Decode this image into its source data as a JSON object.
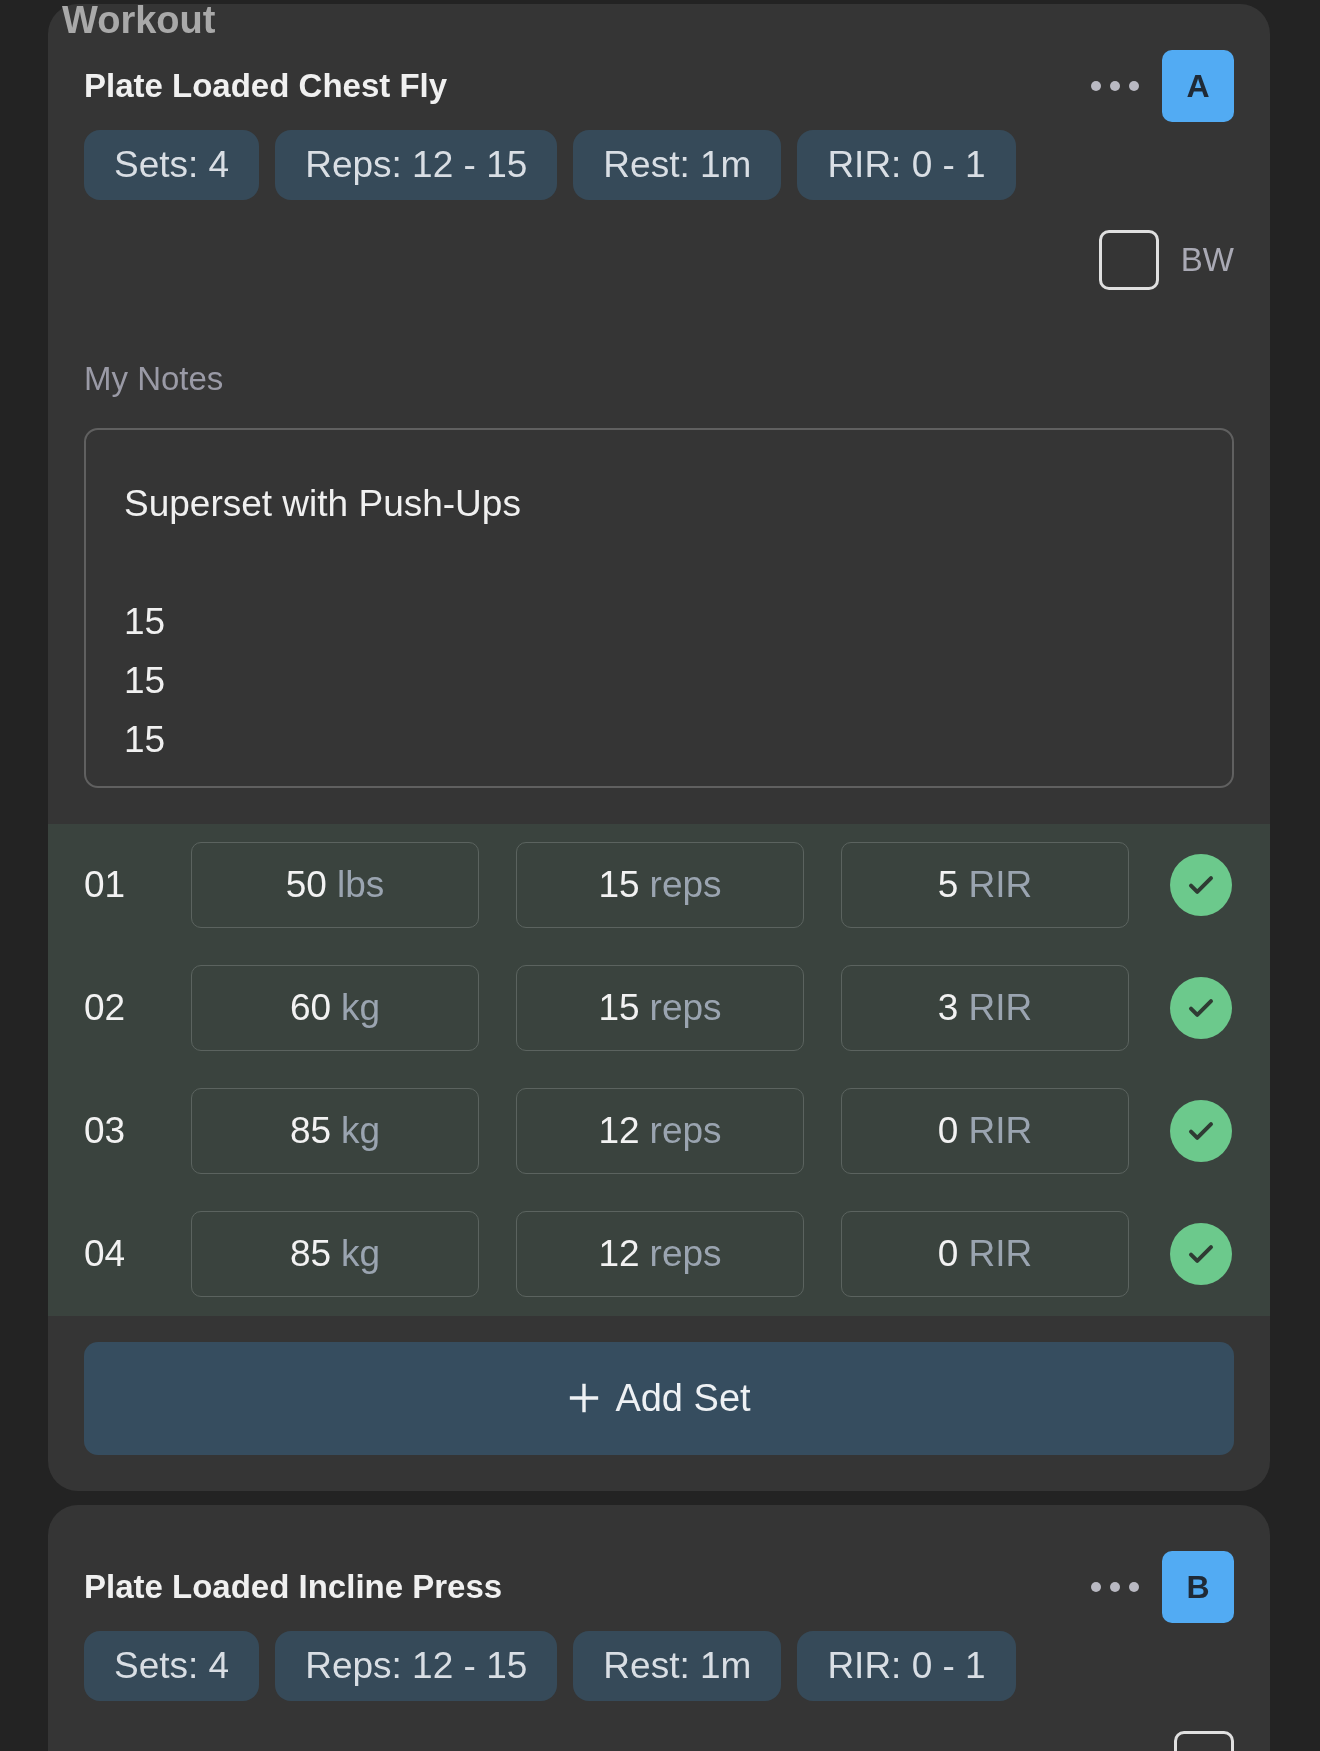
{
  "header": {
    "title": "Workout"
  },
  "exercises": [
    {
      "title": "Plate Loaded Chest Fly",
      "badge": "A",
      "chips": [
        "Sets: 4",
        "Reps: 12 - 15",
        "Rest: 1m",
        "RIR: 0 - 1"
      ],
      "bw": {
        "label": "BW",
        "checked": false
      },
      "notes_label": "My Notes",
      "notes": "Superset with Push-Ups\n\n15\n15\n15",
      "sets": [
        {
          "number": "01",
          "weight": {
            "value": "50",
            "unit": "lbs"
          },
          "reps": {
            "value": "15",
            "unit": "reps"
          },
          "rir": {
            "value": "5",
            "unit": "RIR"
          },
          "done": true
        },
        {
          "number": "02",
          "weight": {
            "value": "60",
            "unit": "kg"
          },
          "reps": {
            "value": "15",
            "unit": "reps"
          },
          "rir": {
            "value": "3",
            "unit": "RIR"
          },
          "done": true
        },
        {
          "number": "03",
          "weight": {
            "value": "85",
            "unit": "kg"
          },
          "reps": {
            "value": "12",
            "unit": "reps"
          },
          "rir": {
            "value": "0",
            "unit": "RIR"
          },
          "done": true
        },
        {
          "number": "04",
          "weight": {
            "value": "85",
            "unit": "kg"
          },
          "reps": {
            "value": "12",
            "unit": "reps"
          },
          "rir": {
            "value": "0",
            "unit": "RIR"
          },
          "done": true
        }
      ],
      "add_set": "Add Set"
    },
    {
      "title": "Plate Loaded Incline Press",
      "badge": "B",
      "chips": [
        "Sets: 4",
        "Reps: 12 - 15",
        "Rest: 1m",
        "RIR: 0 - 1"
      ],
      "bw": {
        "checked": false
      }
    }
  ]
}
